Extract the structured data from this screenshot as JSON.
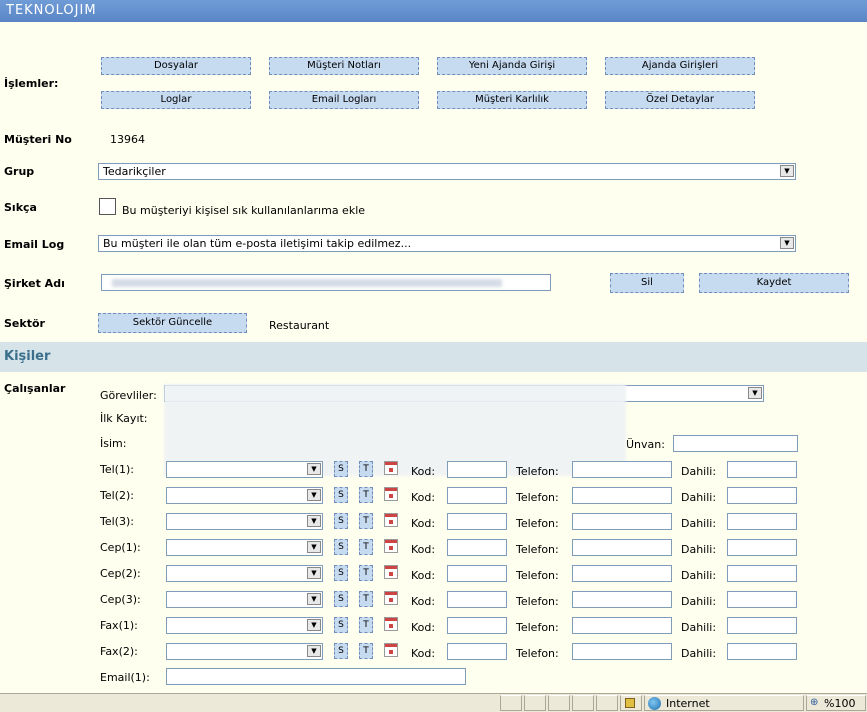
{
  "app": {
    "brand": "TEKNOLOJIM"
  },
  "actions": {
    "label": "İşlemler:",
    "buttons": [
      "Dosyalar",
      "Müşteri Notları",
      "Yeni Ajanda Girişi",
      "Ajanda Girişleri",
      "Loglar",
      "Email Logları",
      "Müşteri Karlılık",
      "Özel Detaylar"
    ]
  },
  "customer": {
    "no_label": "Müşteri No",
    "no_value": "13964",
    "group_label": "Grup",
    "group_value": "Tedarikçiler",
    "frequent_label": "Sıkça",
    "frequent_text": "Bu müşteriyi kişisel sık kullanılanlarıma ekle",
    "email_log_label": "Email Log",
    "email_log_value": "Bu müşteri ile olan tüm e-posta iletişimi takip edilmez...",
    "company_label": "Şirket Adı",
    "delete_label": "Sil",
    "save_label": "Kaydet",
    "sector_label": "Sektör",
    "sector_button": "Sektör Güncelle",
    "sector_value": "Restaurant"
  },
  "people": {
    "section_title": "Kişiler",
    "employees_label": "Çalışanlar",
    "officers_label": "Görevliler:",
    "first_record_label": "İlk Kayıt:",
    "name_label": "İsim:",
    "title_label": "Ünvan:",
    "phone_rows": [
      {
        "label": "Tel(1):"
      },
      {
        "label": "Tel(2):"
      },
      {
        "label": "Tel(3):"
      },
      {
        "label": "Cep(1):"
      },
      {
        "label": "Cep(2):"
      },
      {
        "label": "Cep(3):"
      },
      {
        "label": "Fax(1):"
      },
      {
        "label": "Fax(2):"
      }
    ],
    "s_label": "S",
    "t_label": "T",
    "code_label": "Kod:",
    "phone_label": "Telefon:",
    "ext_label": "Dahili:",
    "email_label": "Email(1):"
  },
  "statusbar": {
    "zone": "Internet",
    "zoom": "%100"
  }
}
